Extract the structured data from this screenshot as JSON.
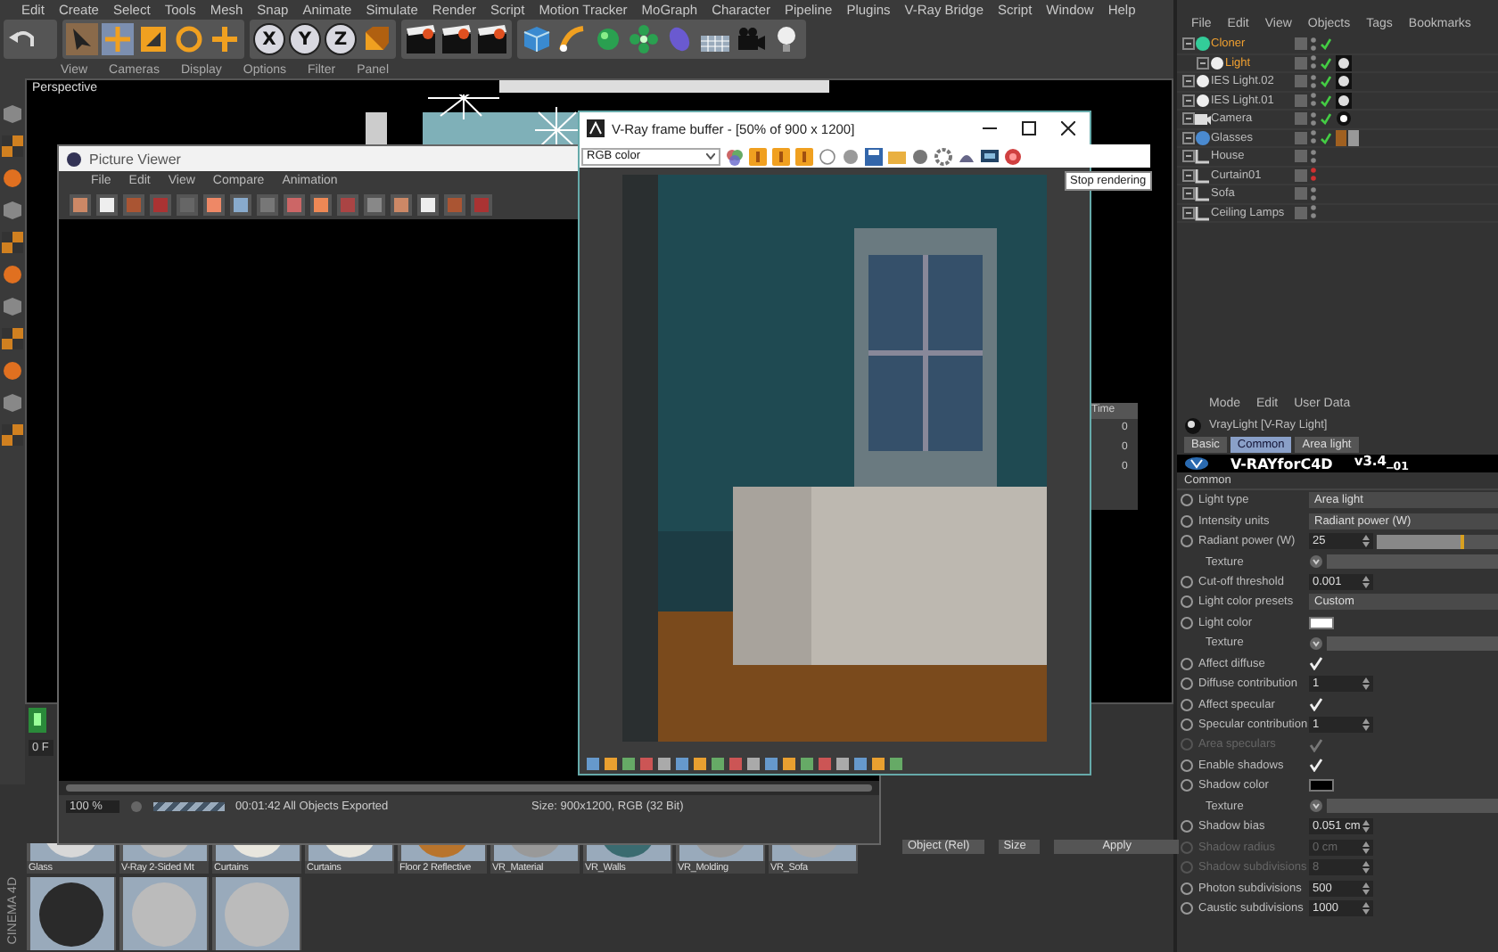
{
  "menubar": {
    "items": [
      "Edit",
      "Create",
      "Select",
      "Tools",
      "Mesh",
      "Snap",
      "Animate",
      "Simulate",
      "Render",
      "Script",
      "Motion Tracker",
      "MoGraph",
      "Character",
      "Pipeline",
      "Plugins",
      "V-Ray Bridge",
      "Script",
      "Window",
      "Help"
    ]
  },
  "toolbar": {
    "axis_buttons": [
      {
        "label": "X"
      },
      {
        "label": "Y"
      },
      {
        "label": "Z"
      }
    ]
  },
  "viewport": {
    "menu": [
      "View",
      "Cameras",
      "Display",
      "Options",
      "Filter",
      "Panel"
    ],
    "camera_label": "Perspective"
  },
  "timeline": {
    "frame": "0 F"
  },
  "object_manager": {
    "menu": [
      "File",
      "Edit",
      "View",
      "Objects",
      "Tags",
      "Bookmarks"
    ],
    "objects": [
      {
        "name": "Cloner",
        "kind": "cloner",
        "selected": true,
        "enabled": true,
        "visible": true,
        "children": [
          {
            "name": "Light",
            "kind": "light",
            "selected": true,
            "enabled": true,
            "visible": true
          }
        ]
      },
      {
        "name": "IES Light.02",
        "kind": "light",
        "selected": false,
        "enabled": true,
        "visible": true
      },
      {
        "name": "IES Light.01",
        "kind": "light",
        "selected": false,
        "enabled": true,
        "visible": true
      },
      {
        "name": "Camera",
        "kind": "camera",
        "selected": false,
        "enabled": true,
        "visible": true
      },
      {
        "name": "Glasses",
        "kind": "sphere",
        "selected": false,
        "enabled": true,
        "visible": true
      },
      {
        "name": "House",
        "kind": "null",
        "selected": false,
        "enabled": false,
        "visible": true
      },
      {
        "name": "Curtain01",
        "kind": "null",
        "selected": false,
        "enabled": false,
        "visible": false
      },
      {
        "name": "Sofa",
        "kind": "null",
        "selected": false,
        "enabled": false,
        "visible": true
      },
      {
        "name": "Ceiling Lamps",
        "kind": "null",
        "selected": false,
        "enabled": false,
        "visible": true
      }
    ]
  },
  "attribute_manager": {
    "menu": [
      "Mode",
      "Edit",
      "User Data"
    ],
    "object_title": "VrayLight [V-Ray Light]",
    "tabs": [
      {
        "label": "Basic",
        "selected": false
      },
      {
        "label": "Common",
        "selected": true
      },
      {
        "label": "Area light",
        "selected": false
      }
    ],
    "banner": "V-RAYforC4D",
    "version": "v3.4_$_{01}$",
    "section": "Common",
    "rows": [
      {
        "kind": "dropdown",
        "label": "Light type",
        "value": "Area light",
        "disabled": false
      },
      {
        "kind": "dropdown",
        "label": "Intensity units",
        "value": "Radiant power (W)",
        "disabled": false
      },
      {
        "kind": "slider",
        "label": "Radiant power (W)",
        "value": "25",
        "level": 0.72,
        "disabled": false
      },
      {
        "kind": "texture",
        "label": "Texture",
        "disabled": false
      },
      {
        "kind": "number",
        "label": "Cut-off threshold",
        "value": "0.001",
        "disabled": false
      },
      {
        "kind": "dropdown",
        "label": "Light color presets",
        "value": "Custom",
        "disabled": false
      },
      {
        "kind": "color",
        "label": "Light color",
        "color": "#ffffff",
        "disabled": false
      },
      {
        "kind": "texture",
        "label": "Texture",
        "disabled": false
      },
      {
        "kind": "check",
        "label": "Affect diffuse",
        "checked": true,
        "disabled": false
      },
      {
        "kind": "number",
        "label": "Diffuse contribution",
        "value": "1",
        "disabled": false
      },
      {
        "kind": "check",
        "label": "Affect specular",
        "checked": true,
        "disabled": false
      },
      {
        "kind": "number",
        "label": "Specular contribution",
        "value": "1",
        "disabled": false
      },
      {
        "kind": "check",
        "label": "Area speculars",
        "checked": true,
        "disabled": true
      },
      {
        "kind": "check",
        "label": "Enable shadows",
        "checked": true,
        "disabled": false
      },
      {
        "kind": "color",
        "label": "Shadow color",
        "color": "#000000",
        "disabled": false
      },
      {
        "kind": "texture",
        "label": "Texture",
        "disabled": false
      },
      {
        "kind": "number",
        "label": "Shadow bias",
        "value": "0.051 cm",
        "disabled": false
      },
      {
        "kind": "number",
        "label": "Shadow radius",
        "value": "0 cm",
        "disabled": true
      },
      {
        "kind": "number",
        "label": "Shadow subdivisions",
        "value": "8",
        "disabled": true
      },
      {
        "kind": "number",
        "label": "Photon subdivisions",
        "value": "500",
        "disabled": false
      },
      {
        "kind": "number",
        "label": "Caustic subdivisions",
        "value": "1000",
        "disabled": false
      }
    ]
  },
  "material_manager": {
    "app_label": "CINEMA 4D",
    "materials": [
      {
        "name": "Glass"
      },
      {
        "name": "V-Ray 2-Sided Mt"
      },
      {
        "name": "Curtains"
      },
      {
        "name": "Curtains"
      },
      {
        "name": "Floor 2 Reflective"
      },
      {
        "name": "VR_Material"
      },
      {
        "name": "VR_Walls"
      },
      {
        "name": "VR_Molding"
      },
      {
        "name": "VR_Sofa"
      }
    ],
    "coordinates": {
      "mode": "Object (Rel)",
      "size": "Size",
      "apply": "Apply"
    }
  },
  "side_panel": {
    "column_1": "Time",
    "values": [
      "0",
      "0",
      "0"
    ]
  },
  "picture_viewer": {
    "title": "Picture Viewer",
    "menu": [
      "File",
      "Edit",
      "View",
      "Compare",
      "Animation"
    ],
    "zoom": "100 %",
    "progress": {
      "level": 1
    },
    "status": "00:01:42 All Objects Exported",
    "size_info": "Size: 900x1200, RGB (32 Bit)"
  },
  "frame_buffer": {
    "title": "V-Ray frame buffer - [50% of 900 x 1200]",
    "channel": "RGB color",
    "tooltip": "Stop rendering"
  }
}
